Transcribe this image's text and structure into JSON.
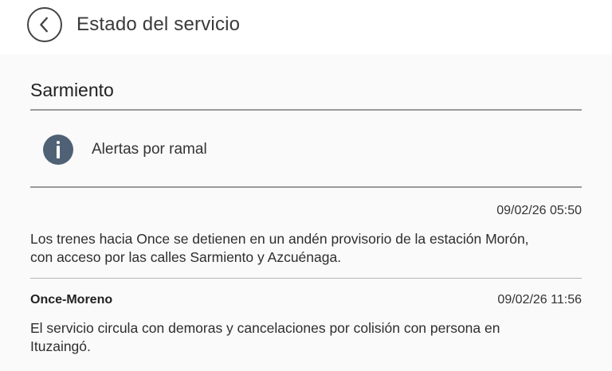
{
  "appbar": {
    "title": "Estado del servicio",
    "back_icon": "chevron-left-icon"
  },
  "section": {
    "title": "Sarmiento"
  },
  "info": {
    "icon": "info-icon",
    "label": "Alertas por ramal"
  },
  "alerts": [
    {
      "line": "",
      "date": "09/02/26 05:50",
      "text": "Los trenes hacia Once se detienen en un andén provisorio de la estación Morón, con acceso por las calles Sarmiento y Azcuénaga."
    },
    {
      "line": "Once-Moreno",
      "date": "09/02/26 11:56",
      "text": "El servicio circula con demoras y cancelaciones por colisión con persona en Ituzaingó."
    }
  ],
  "colors": {
    "info_icon_bg": "#4f6275",
    "divider": "#9a9a9a",
    "background": "#fafafa"
  }
}
